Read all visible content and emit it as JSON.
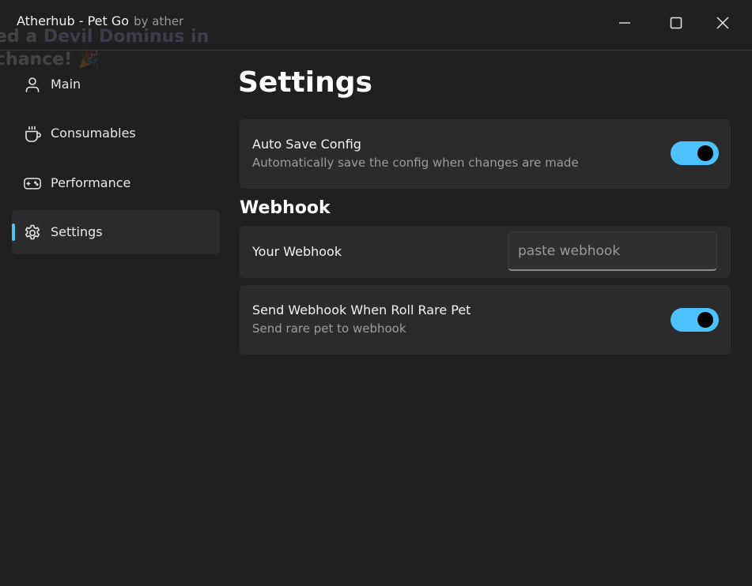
{
  "window": {
    "title": "Atherhub - Pet Go",
    "subtitle": "by ather",
    "controls": [
      "minimize-icon",
      "maximize-icon",
      "close-icon"
    ]
  },
  "background_text": {
    "line1_prefix": "ed a ",
    "line1_highlight": "Devil Dominus in",
    "line2": "chance! 🎉"
  },
  "sidebar": {
    "items": [
      {
        "label": "Main",
        "icon": "person-icon",
        "active": false
      },
      {
        "label": "Consumables",
        "icon": "cup-icon",
        "active": false
      },
      {
        "label": "Performance",
        "icon": "gamepad-icon",
        "active": false
      },
      {
        "label": "Settings",
        "icon": "gear-icon",
        "active": true
      }
    ]
  },
  "main": {
    "title": "Settings",
    "auto_save": {
      "title": "Auto Save Config",
      "description": "Automatically save the config when changes are made",
      "enabled": true
    },
    "webhook_section": {
      "heading": "Webhook",
      "your_webhook": {
        "label": "Your Webhook",
        "value": "",
        "placeholder": "paste webhook"
      },
      "send_rare": {
        "title": "Send Webhook When Roll Rare Pet",
        "description": "Send rare pet to webhook",
        "enabled": true
      }
    }
  },
  "colors": {
    "background": "#202020",
    "card": "#2b2b2b",
    "accent": "#4cc2ff"
  }
}
